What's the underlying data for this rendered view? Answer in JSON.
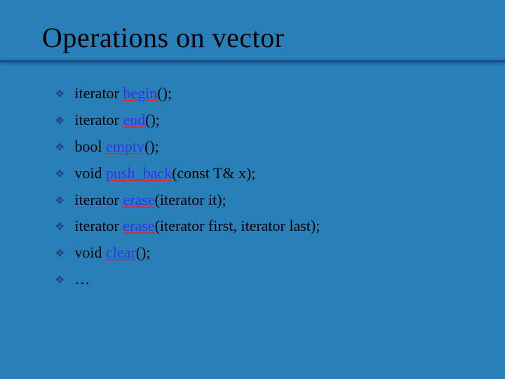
{
  "title": "Operations on vector",
  "items": [
    {
      "prefix": "iterator ",
      "keyword": "begin",
      "suffix": "();"
    },
    {
      "prefix": "iterator ",
      "keyword": "end",
      "suffix": "();"
    },
    {
      "prefix": "bool ",
      "keyword": "empty",
      "suffix": "();"
    },
    {
      "prefix": "void ",
      "keyword": "push_back",
      "suffix": "(const T& x);"
    },
    {
      "prefix": "iterator ",
      "keyword": "erase",
      "suffix": "(iterator it);"
    },
    {
      "prefix": "iterator ",
      "keyword": "erase",
      "suffix": "(iterator first, iterator last);"
    },
    {
      "prefix": "void ",
      "keyword": "clear",
      "suffix": "();"
    },
    {
      "prefix": "…",
      "keyword": "",
      "suffix": ""
    }
  ]
}
